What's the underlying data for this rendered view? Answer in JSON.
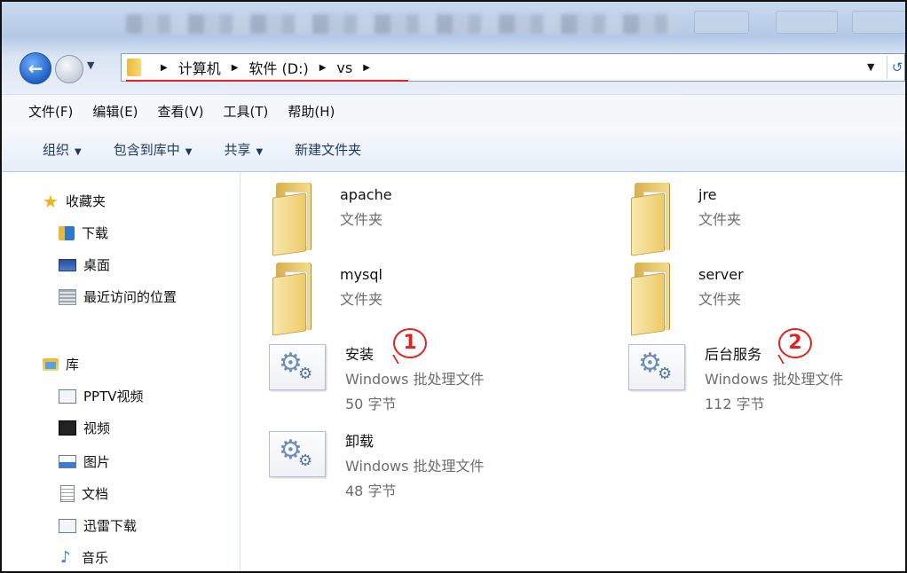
{
  "address_bar": {
    "breadcrumbs": [
      "计算机",
      "软件 (D:)",
      "vs"
    ]
  },
  "menu": {
    "items": [
      "文件(F)",
      "编辑(E)",
      "查看(V)",
      "工具(T)",
      "帮助(H)"
    ]
  },
  "toolbar": {
    "organize": "组织",
    "include_in_library": "包含到库中",
    "share": "共享",
    "new_folder": "新建文件夹"
  },
  "sidebar": {
    "favorites": {
      "label": "收藏夹",
      "items": [
        "下载",
        "桌面",
        "最近访问的位置"
      ]
    },
    "libraries": {
      "label": "库",
      "items": [
        "PPTV视频",
        "视频",
        "图片",
        "文档",
        "迅雷下载",
        "音乐"
      ]
    }
  },
  "files": [
    {
      "name": "apache",
      "type": "文件夹",
      "icon": "folder-icon"
    },
    {
      "name": "jre",
      "type": "文件夹",
      "icon": "folder-icon"
    },
    {
      "name": "mysql",
      "type": "文件夹",
      "icon": "folder-icon"
    },
    {
      "name": "server",
      "type": "文件夹",
      "icon": "folder-icon"
    },
    {
      "name": "安装",
      "type": "Windows 批处理文件",
      "size": "50 字节",
      "icon": "batch-file-icon"
    },
    {
      "name": "后台服务",
      "type": "Windows 批处理文件",
      "size": "112 字节",
      "icon": "batch-file-icon"
    },
    {
      "name": "卸载",
      "type": "Windows 批处理文件",
      "size": "48 字节",
      "icon": "batch-file-icon"
    }
  ],
  "annotations": {
    "step1": "1",
    "step2": "2",
    "color": "#e02222"
  }
}
